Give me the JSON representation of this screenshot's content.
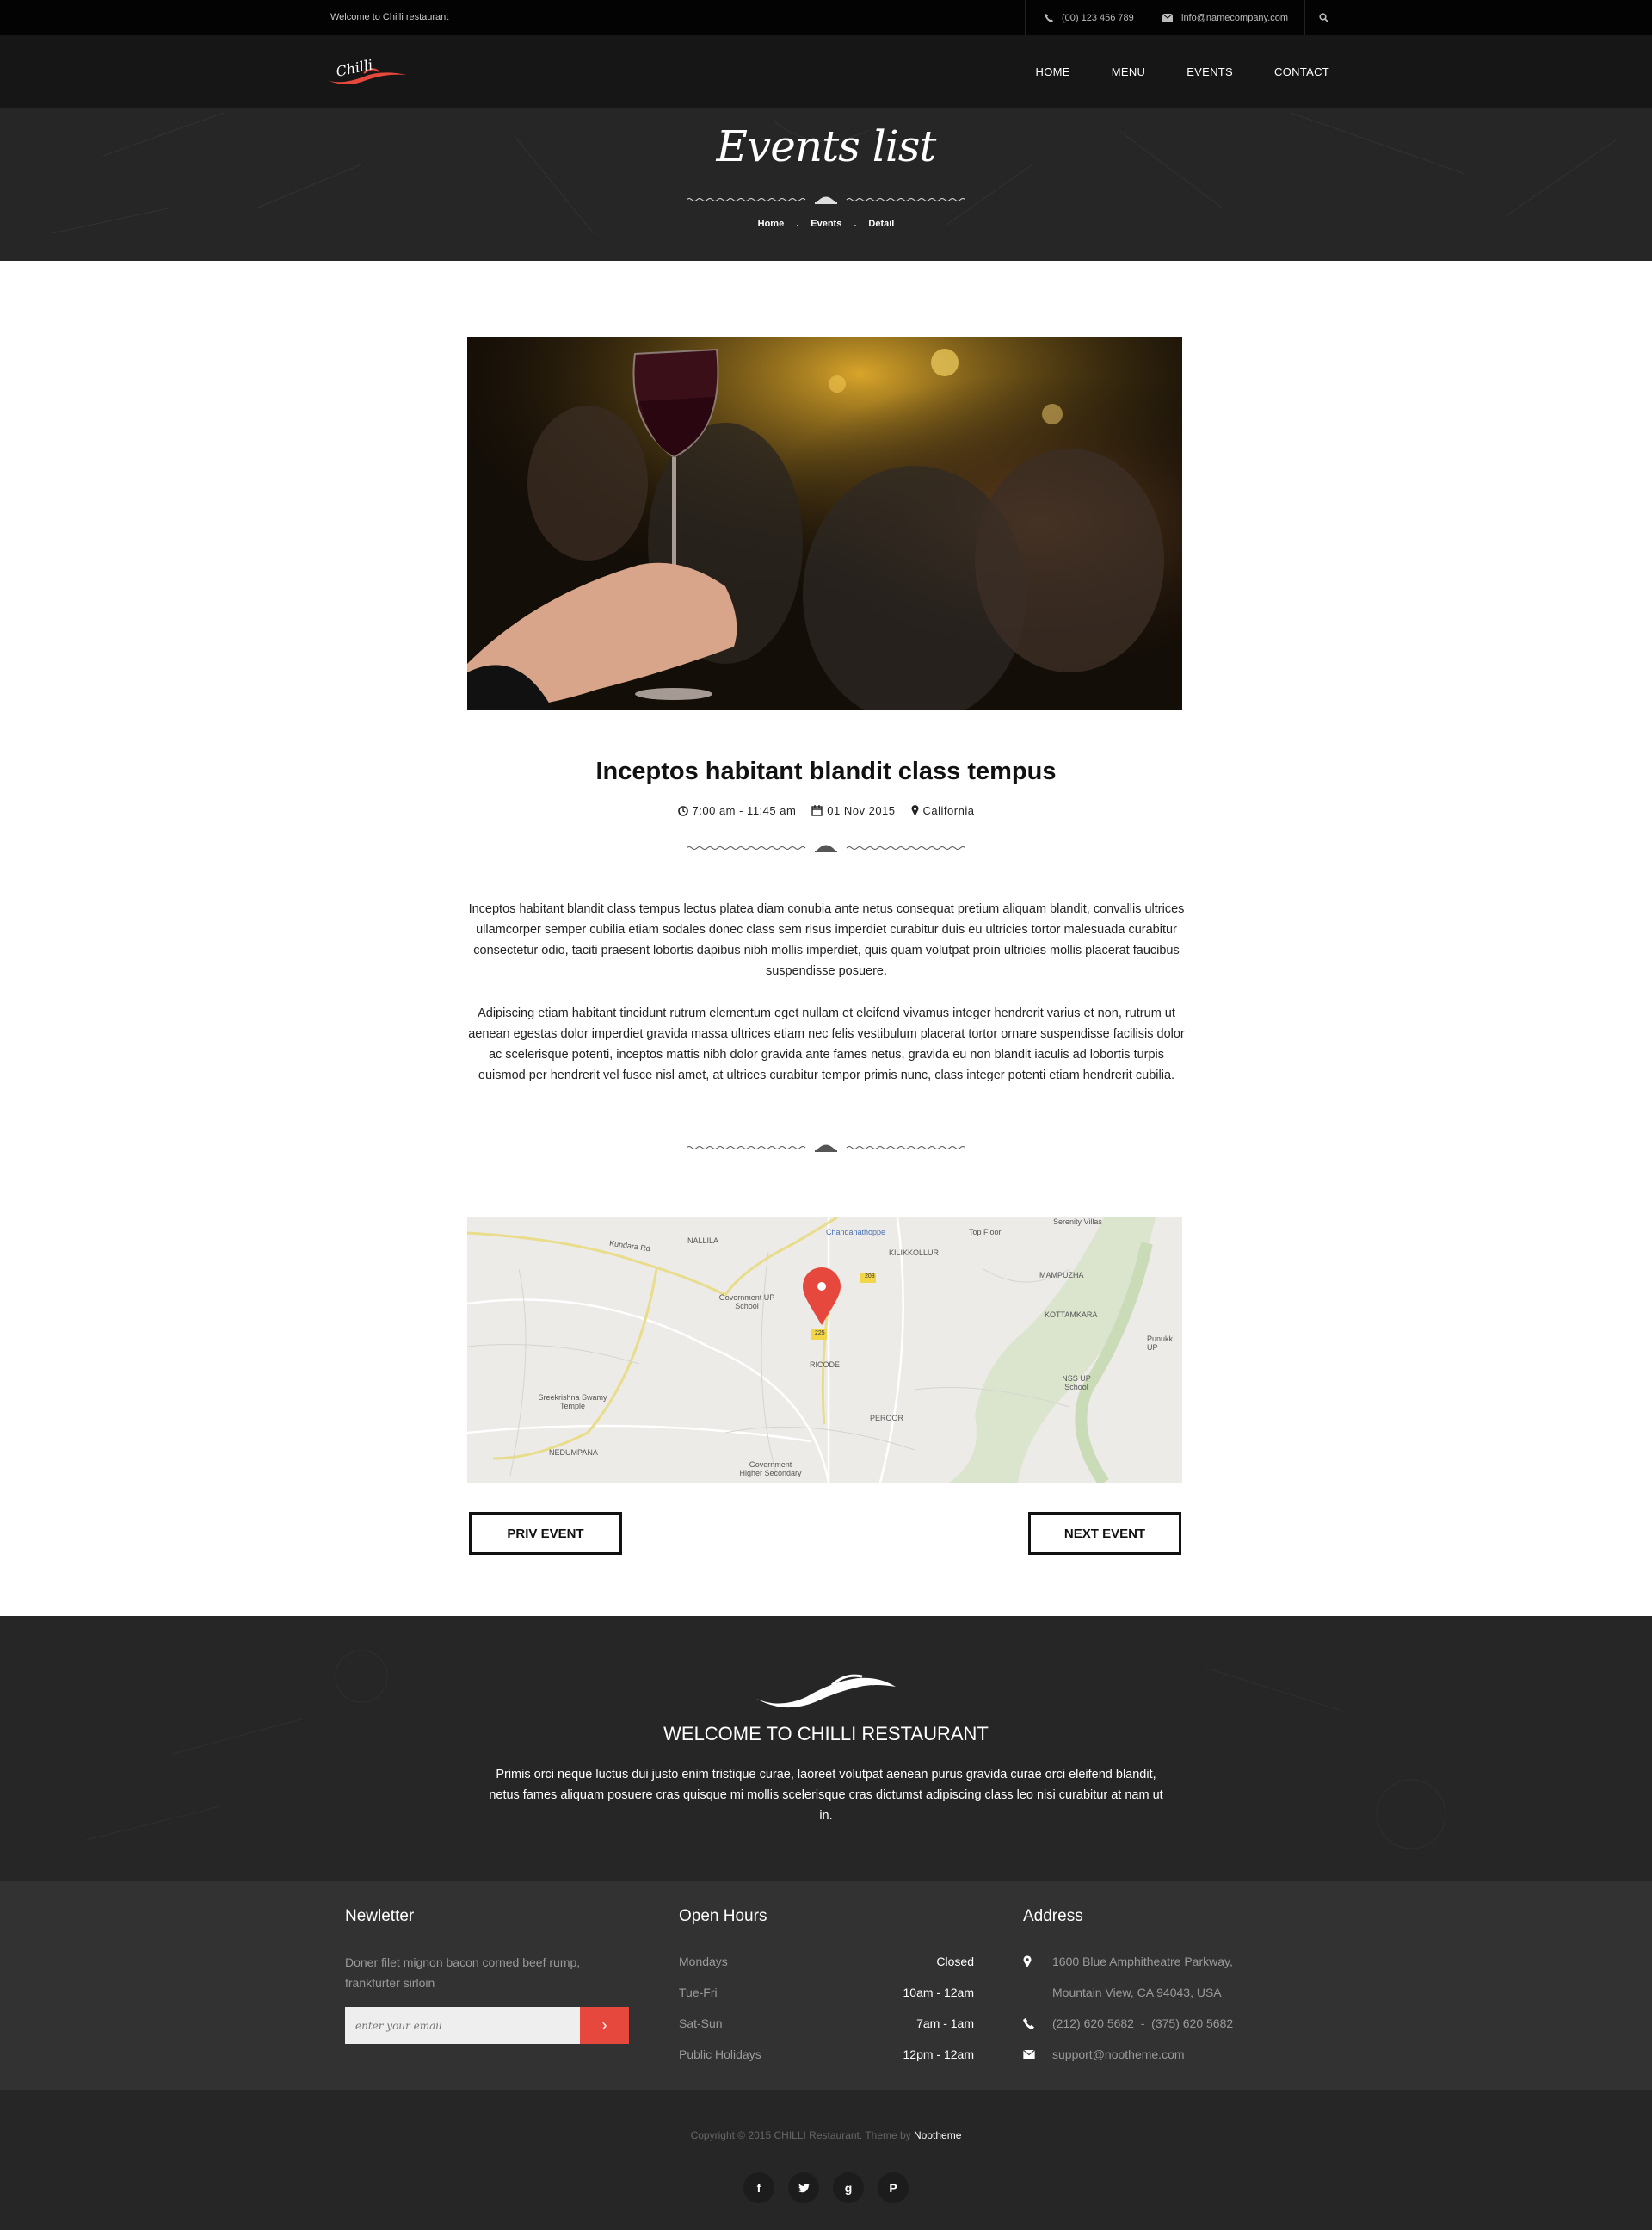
{
  "topbar": {
    "welcome": "Welcome to Chilli restaurant",
    "phone": "(00) 123 456 789",
    "email": "info@namecompany.com"
  },
  "brand": {
    "logo_text": "Chilli",
    "accent_color": "#e6483d"
  },
  "nav": {
    "items": [
      "HOME",
      "MENU",
      "EVENTS",
      "CONTACT"
    ]
  },
  "hero": {
    "title": "Events list",
    "breadcrumb": [
      "Home",
      "Events",
      "Detail"
    ]
  },
  "event": {
    "title": "Inceptos habitant blandit class tempus",
    "time": "7:00 am - 11:45 am",
    "date": "01 Nov 2015",
    "location": "California",
    "paragraphs": [
      "Inceptos habitant blandit class tempus lectus platea diam conubia ante netus consequat pretium aliquam blandit, convallis ultrices ullamcorper semper cubilia etiam sodales donec class sem risus imperdiet curabitur duis eu ultricies tortor malesuada curabitur consectetur odio, taciti praesent lobortis dapibus nibh mollis imperdiet, quis quam volutpat proin ultricies mollis placerat faucibus suspendisse posuere.",
      "Adipiscing etiam habitant tincidunt rutrum elementum eget nullam et eleifend vivamus integer hendrerit varius et non, rutrum ut aenean egestas dolor imperdiet gravida massa ultrices etiam nec felis vestibulum placerat tortor ornare suspendisse facilisis dolor ac scelerisque potenti, inceptos mattis nibh dolor gravida ante fames netus, gravida eu non blandit iaculis ad lobortis turpis euismod per hendrerit vel fusce nisl amet, at ultrices curabitur tempor primis nunc, class integer potenti etiam hendrerit cubilia."
    ]
  },
  "map": {
    "labels": {
      "chandanathoppe": "Chandanathoppe",
      "serenity": "Serenity Villas",
      "kundara": "Kundara Rd",
      "nallila": "NALLILA",
      "kilikkollur": "KILIKKOLLUR",
      "topfloor": "Top Floor",
      "mampuzha": "MAMPUZHA",
      "govt_up": "Government UP School",
      "kottamkara": "KOTTAMKARA",
      "punukk": "Punukk UP",
      "ricode": "RICODE",
      "nss": "NSS UP School",
      "sreekrishna": "Sreekrishna Swamy Temple",
      "peroor": "PEROOR",
      "nedumpana": "NEDUMPANA",
      "govt_higher": "Government Higher Secondary",
      "road_208": "208",
      "road_225": "225"
    }
  },
  "pager": {
    "prev": "PRIV EVENT",
    "next": "NEXT EVENT"
  },
  "footer_welcome": {
    "title": "WELCOME TO CHILLI RESTAURANT",
    "text": "Primis orci neque luctus dui justo enim tristique curae, laoreet volutpat aenean purus gravida curae orci eleifend blandit, netus fames aliquam posuere cras quisque mi mollis scelerisque cras dictumst adipiscing class leo nisi curabitur at nam ut in."
  },
  "newsletter": {
    "title": "Newletter",
    "text": "Doner filet mignon bacon corned beef rump, frankfurter sirloin",
    "placeholder": "enter your email"
  },
  "hours": {
    "title": "Open Hours",
    "rows": [
      {
        "day": "Mondays",
        "time": "Closed"
      },
      {
        "day": "Tue-Fri",
        "time": "10am - 12am"
      },
      {
        "day": "Sat-Sun",
        "time": "7am - 1am"
      },
      {
        "day": "Public Holidays",
        "time": "12pm - 12am"
      }
    ]
  },
  "address": {
    "title": "Address",
    "line1": "1600 Blue Amphitheatre Parkway,",
    "line2": "Mountain View, CA 94043, USA",
    "phones": "(212) 620 5682  -  (375) 620 5682",
    "email": "support@nootheme.com"
  },
  "copyright": {
    "text": "Copyright © 2015 CHILLI Restaurant. Theme by ",
    "author": "Nootheme"
  },
  "socials": [
    "facebook-icon",
    "twitter-icon",
    "google-plus-icon",
    "pinterest-icon"
  ]
}
